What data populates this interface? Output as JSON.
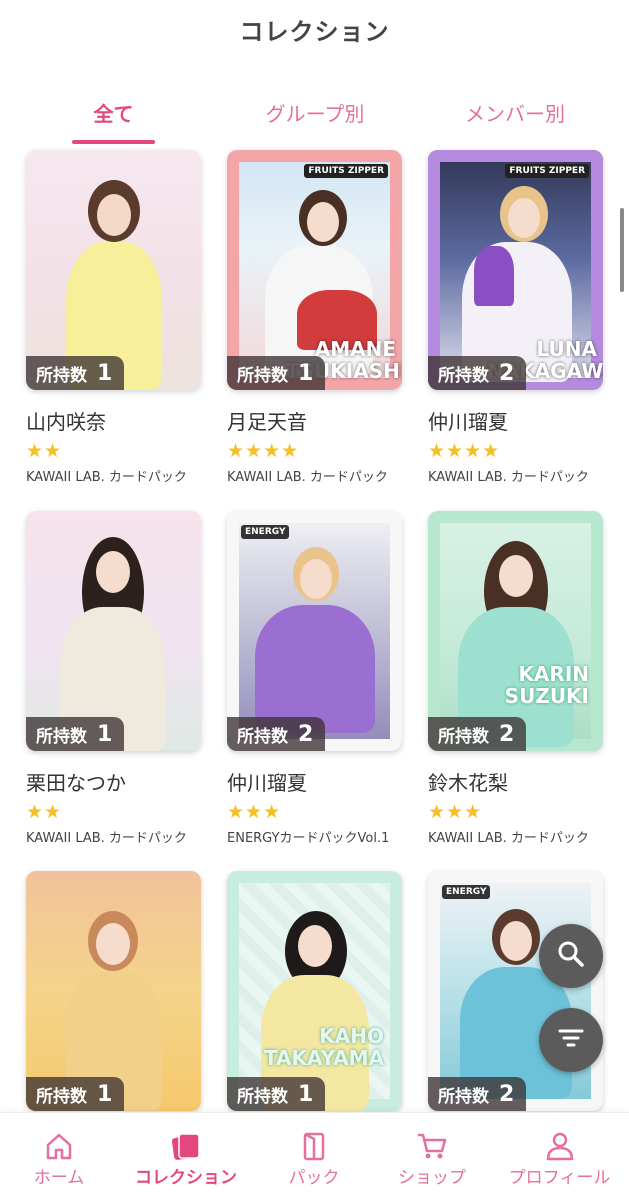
{
  "header": {
    "title": "コレクション"
  },
  "tabs": [
    {
      "label": "全て",
      "active": true
    },
    {
      "label": "グループ別",
      "active": false
    },
    {
      "label": "メンバー別",
      "active": false
    }
  ],
  "owned_label": "所持数",
  "cards": [
    {
      "name": "山内咲奈",
      "stars": "★★",
      "rating": 2,
      "pack": "KAWAII LAB. カードパック",
      "count": "1",
      "overlay": ""
    },
    {
      "name": "月足天音",
      "stars": "★★★★",
      "rating": 4,
      "pack": "KAWAII LAB. カードパック",
      "count": "1",
      "overlay": "AMANE TSUKIASHI"
    },
    {
      "name": "仲川瑠夏",
      "stars": "★★★★",
      "rating": 4,
      "pack": "KAWAII LAB. カードパック",
      "count": "2",
      "overlay": "LUNA NAKAGAWA"
    },
    {
      "name": "栗田なつか",
      "stars": "★★",
      "rating": 2,
      "pack": "KAWAII LAB. カードパック",
      "count": "1",
      "overlay": ""
    },
    {
      "name": "仲川瑠夏",
      "stars": "★★★",
      "rating": 3,
      "pack": "ENERGYカードパックVol.1",
      "count": "2",
      "overlay": ""
    },
    {
      "name": "鈴木花梨",
      "stars": "★★★",
      "rating": 3,
      "pack": "KAWAII LAB. カードパック",
      "count": "2",
      "overlay": "KARIN SUZUKI"
    },
    {
      "name": "",
      "stars": "",
      "rating": 0,
      "pack": "",
      "count": "1",
      "overlay": ""
    },
    {
      "name": "",
      "stars": "",
      "rating": 0,
      "pack": "",
      "count": "1",
      "overlay": "KAHO TAKAYAMA"
    },
    {
      "name": "",
      "stars": "",
      "rating": 0,
      "pack": "",
      "count": "2",
      "overlay": ""
    }
  ],
  "card_brand": {
    "fruits_zipper": "FRUITS ZIPPER",
    "energy": "ENERGY"
  },
  "fabs": {
    "search_icon": "search-icon",
    "filter_icon": "filter-icon"
  },
  "bottom_nav": [
    {
      "label": "ホーム",
      "icon": "home-icon",
      "active": false
    },
    {
      "label": "コレクション",
      "icon": "collection-icon",
      "active": true
    },
    {
      "label": "パック",
      "icon": "pack-icon",
      "active": false
    },
    {
      "label": "ショップ",
      "icon": "cart-icon",
      "active": false
    },
    {
      "label": "プロフィール",
      "icon": "profile-icon",
      "active": false
    }
  ],
  "colors": {
    "accent": "#e3477f",
    "accent_light": "#e56fa0",
    "star": "#f4c025",
    "fab": "#5b5b5b"
  }
}
